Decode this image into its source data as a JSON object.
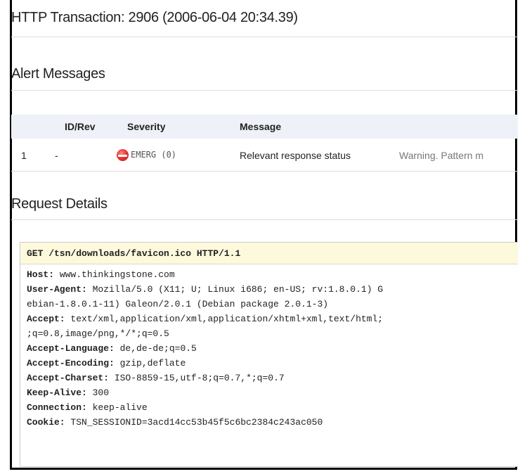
{
  "page": {
    "title": "HTTP Transaction: 2906 (2006-06-04 20:34.39)"
  },
  "alerts": {
    "heading": "Alert Messages",
    "columns": {
      "num": "",
      "id_rev": "ID/Rev",
      "severity": "Severity",
      "message": "Message",
      "detail": ""
    },
    "rows": [
      {
        "num": "1",
        "id_rev": "-",
        "severity": "EMERG (0)",
        "message": "Relevant response status",
        "detail": "Warning. Pattern m"
      }
    ]
  },
  "request": {
    "heading": "Request Details",
    "request_line": "GET /tsn/downloads/favicon.ico HTTP/1.1",
    "lines": [
      {
        "key": "Host:",
        "value": " www.thinkingstone.com"
      },
      {
        "key": "User-Agent:",
        "value": " Mozilla/5.0 (X11; U; Linux i686; en-US; rv:1.8.0.1) G"
      },
      {
        "key": "",
        "value": "ebian-1.8.0.1-11) Galeon/2.0.1 (Debian package 2.0.1-3)"
      },
      {
        "key": "Accept:",
        "value": " text/xml,application/xml,application/xhtml+xml,text/html;"
      },
      {
        "key": "",
        "value": ";q=0.8,image/png,*/*;q=0.5"
      },
      {
        "key": "Accept-Language:",
        "value": " de,de-de;q=0.5"
      },
      {
        "key": "Accept-Encoding:",
        "value": " gzip,deflate"
      },
      {
        "key": "Accept-Charset:",
        "value": " ISO-8859-15,utf-8;q=0.7,*;q=0.7"
      },
      {
        "key": "Keep-Alive:",
        "value": " 300"
      },
      {
        "key": "Connection:",
        "value": " keep-alive"
      },
      {
        "key": "Cookie:",
        "value": " TSN_SESSIONID=3acd14cc53b45f5c6bc2384c243ac050"
      }
    ]
  },
  "colors": {
    "border": "#000000",
    "table_header_bg": "#eef1f8",
    "code_header_bg": "#fdf9dc",
    "severity_emerg": "#e53935"
  },
  "icons": {
    "severity": "no-entry-icon"
  }
}
